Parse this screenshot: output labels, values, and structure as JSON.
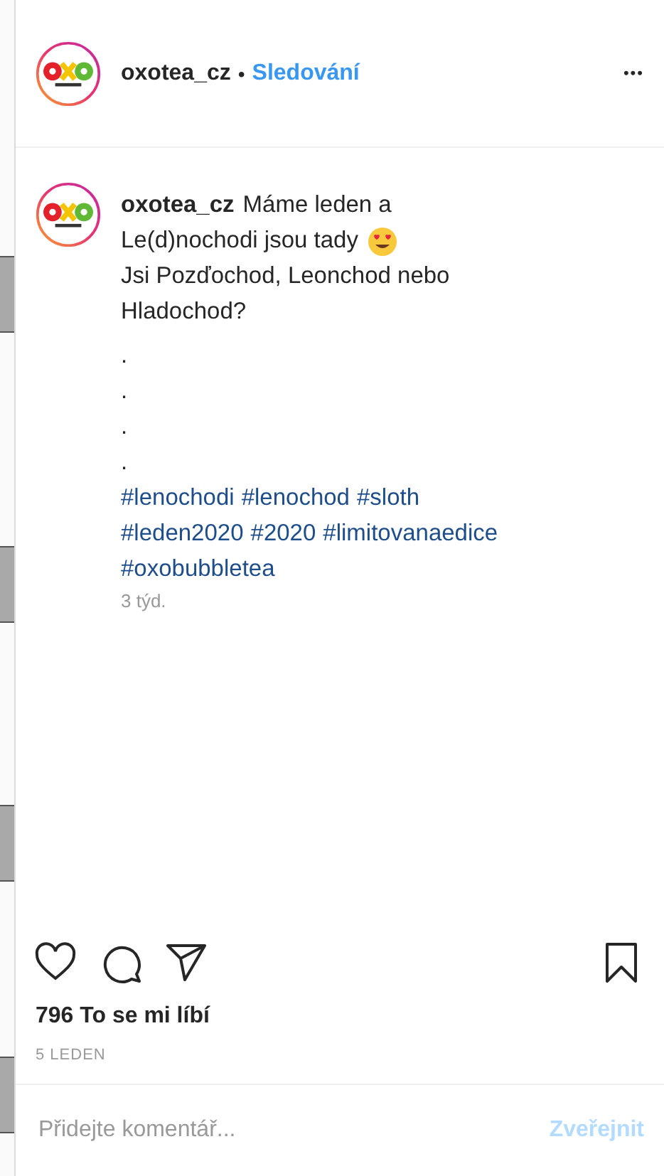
{
  "header": {
    "username": "oxotea_cz",
    "separator": "•",
    "follow_label": "Sledování",
    "more": "•••"
  },
  "caption": {
    "username": "oxotea_cz",
    "lines": [
      {
        "text": "Máme leden a",
        "emoji": false
      },
      {
        "text": "Le(d)nochodi jsou tady",
        "emoji": true
      },
      {
        "text": "Jsi Pozďochod, Leonchod nebo",
        "emoji": false
      },
      {
        "text": "Hladochod?",
        "emoji": false
      }
    ],
    "dots": [
      ".",
      ".",
      ".",
      "."
    ],
    "hashtag_lines": [
      [
        "#lenochodi",
        "#lenochod",
        "#sloth"
      ],
      [
        "#leden2020",
        "#2020",
        "#limitovanaedice"
      ],
      [
        "#oxobubbletea"
      ]
    ],
    "time": "3 týd."
  },
  "likes": "796 To se mi líbí",
  "date": "5 LEDEN",
  "comment": {
    "placeholder": "Přidejte komentář...",
    "post_button": {
      "label": "Zveřejnit",
      "disabled": true
    }
  }
}
